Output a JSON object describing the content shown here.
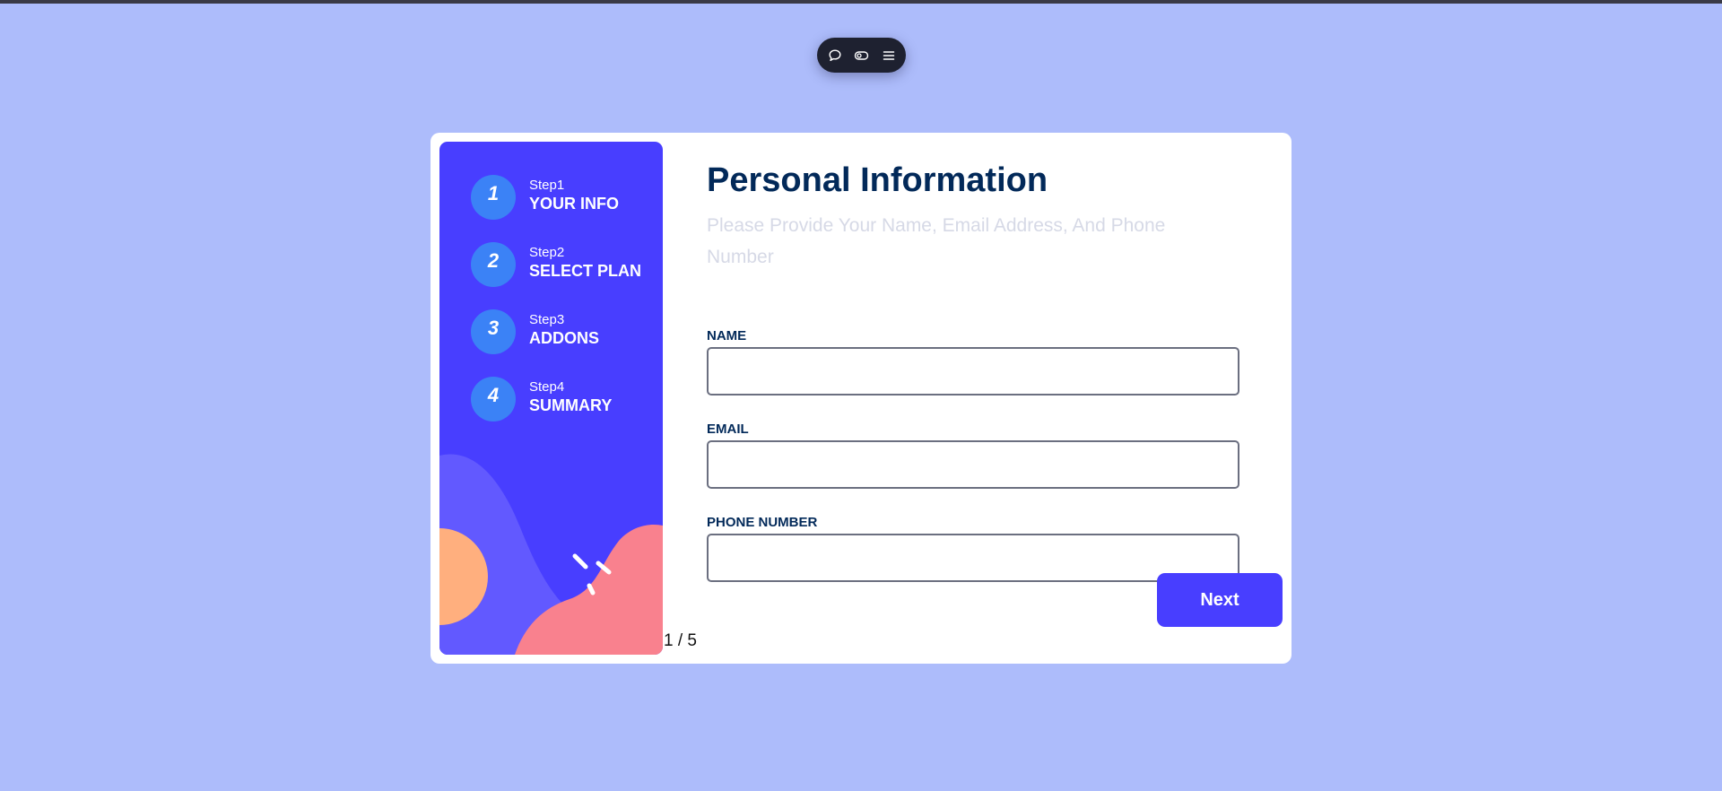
{
  "toolbar": {
    "items": [
      {
        "icon": "comment-icon"
      },
      {
        "icon": "toggle-icon"
      },
      {
        "icon": "menu-icon"
      }
    ]
  },
  "sidebar": {
    "steps": [
      {
        "number": "1",
        "caption": "Step1",
        "title": "YOUR INFO"
      },
      {
        "number": "2",
        "caption": "Step2",
        "title": "SELECT PLAN"
      },
      {
        "number": "3",
        "caption": "Step3",
        "title": "ADDONS"
      },
      {
        "number": "4",
        "caption": "Step4",
        "title": "SUMMARY"
      }
    ]
  },
  "pagination": {
    "text": "1 / 5"
  },
  "form": {
    "title": "Personal Information",
    "subtitle": "Please Provide Your Name, Email Address, And Phone Number",
    "fields": {
      "name": {
        "label": "NAME",
        "value": "",
        "placeholder": ""
      },
      "email": {
        "label": "EMAIL",
        "value": "",
        "placeholder": ""
      },
      "phone": {
        "label": "PHONE NUMBER",
        "value": "",
        "placeholder": ""
      }
    },
    "next_label": "Next"
  },
  "colors": {
    "page_background": "#adbcfb",
    "sidebar_background": "#483eff",
    "step_circle": "#3b82f6",
    "title_text": "#022959",
    "subtitle_text": "#d6d9e6",
    "primary_button": "#483eff"
  }
}
